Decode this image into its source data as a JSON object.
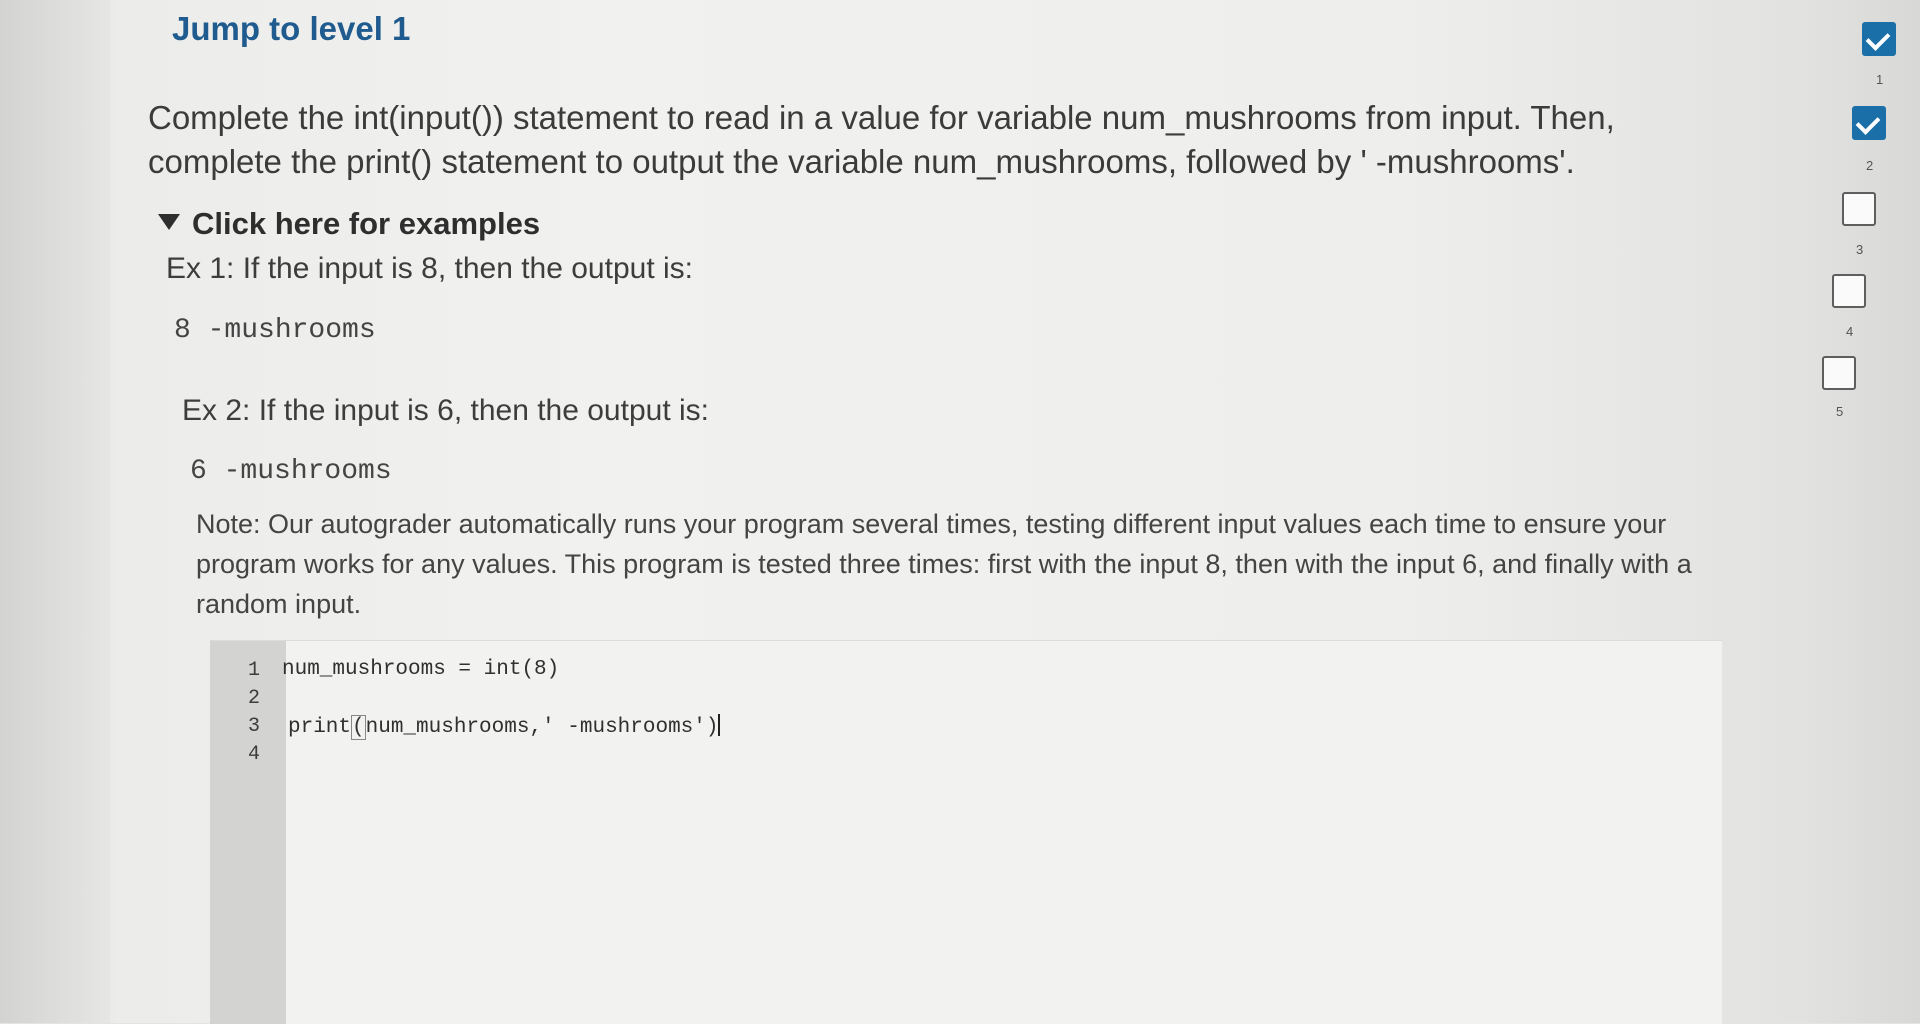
{
  "header": {
    "jump_link": "Jump to level 1"
  },
  "instructions": {
    "text": "Complete the int(input()) statement to read in a value for variable num_mushrooms from input. Then, complete the print() statement to output the variable num_mushrooms, followed by ' -mushrooms'."
  },
  "examples": {
    "toggle_label": "Click here for examples",
    "ex1_label": "Ex 1: If the input is 8, then the output is:",
    "ex1_output": "8 -mushrooms",
    "ex2_label": "Ex 2: If the input is 6, then the output is:",
    "ex2_output": "6 -mushrooms"
  },
  "note": {
    "text": "Note: Our autograder automatically runs your program several times, testing different input values each time to ensure your program works for any values. This program is tested three times: first with the input 8, then with the input 6, and finally with a random input."
  },
  "editor": {
    "line_numbers": [
      "1",
      "2",
      "3",
      "4"
    ],
    "line1": "num_mushrooms = int(8)",
    "line3_func": "print",
    "line3_args": "num_mushrooms,' -mushrooms')",
    "line3_close": ")"
  },
  "progress": {
    "levels": [
      {
        "number": "1",
        "status": "done"
      },
      {
        "number": "2",
        "status": "done"
      },
      {
        "number": "3",
        "status": "todo"
      },
      {
        "number": "4",
        "status": "todo"
      },
      {
        "number": "5",
        "status": "todo"
      }
    ],
    "done_color": "#1b6fa8"
  }
}
